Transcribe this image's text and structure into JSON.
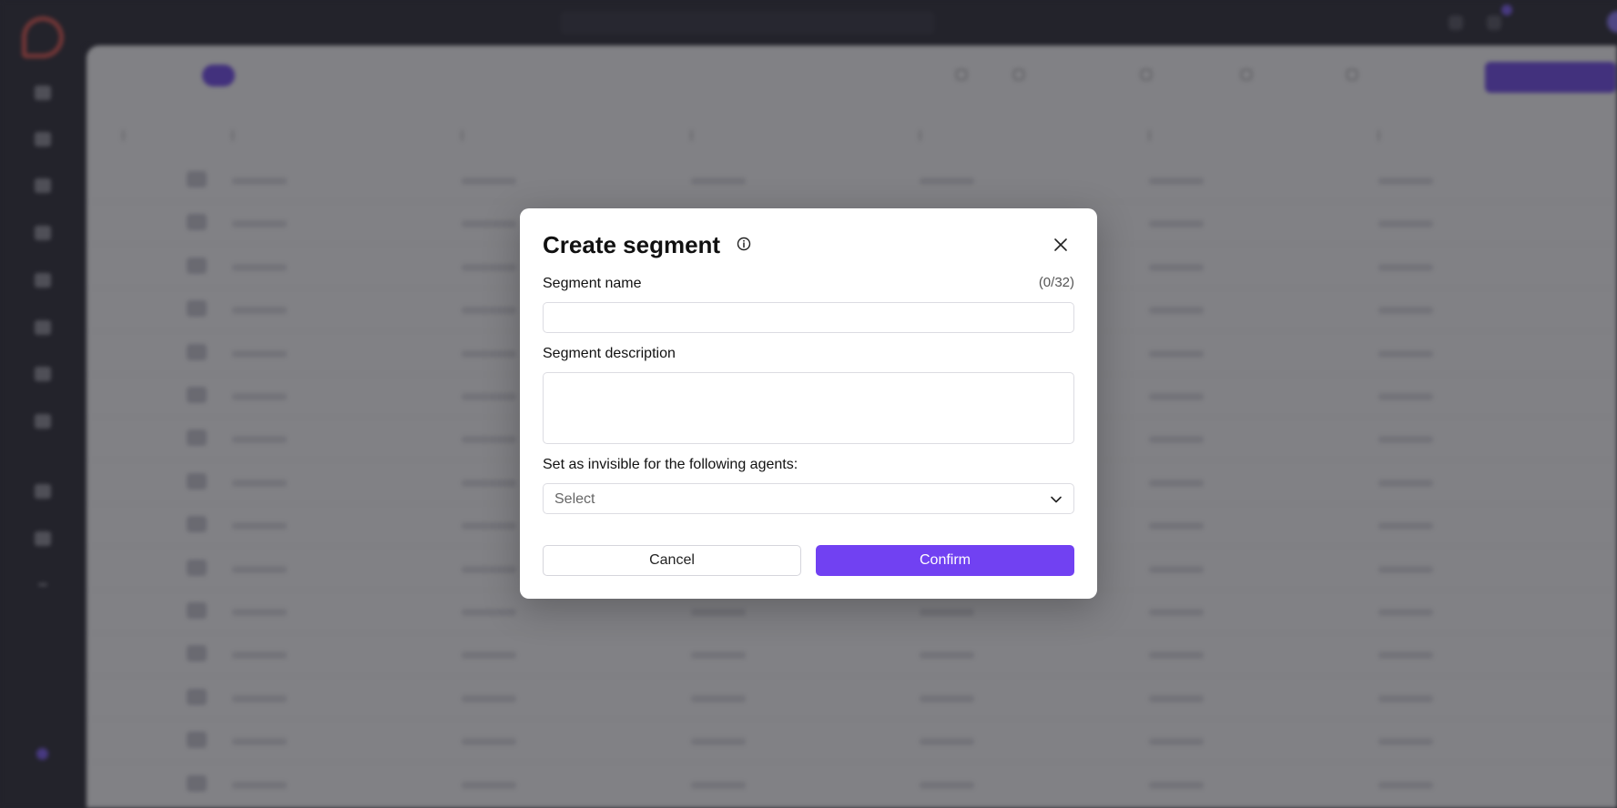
{
  "modal": {
    "title": "Create segment",
    "name_label": "Segment name",
    "name_counter": "(0/32)",
    "name_value": "",
    "description_label": "Segment description",
    "description_value": "",
    "invisible_label": "Set as invisible for the following agents:",
    "select_value": "Select",
    "cancel_label": "Cancel",
    "confirm_label": "Confirm"
  },
  "colors": {
    "accent": "#7141f2",
    "overlay": "#1e1e24",
    "sidebar": "#2a2a33"
  },
  "icons": {
    "info": "info-icon",
    "close": "close-icon",
    "dropdown": "chevron-down-icon"
  }
}
